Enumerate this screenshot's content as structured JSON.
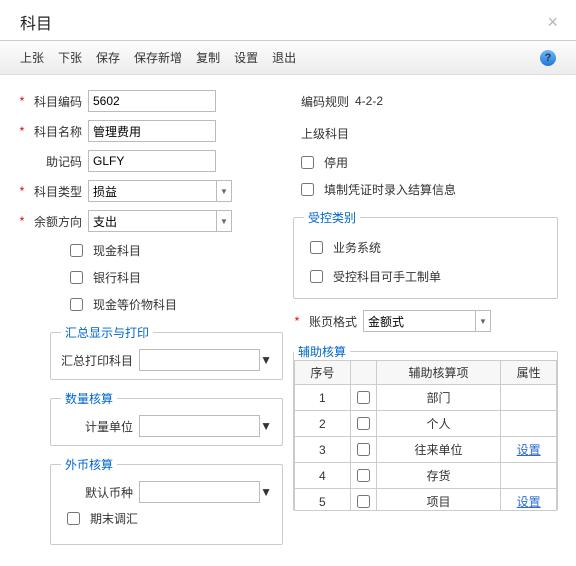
{
  "header": {
    "title": "科目"
  },
  "toolbar": {
    "prev": "上张",
    "next": "下张",
    "save": "保存",
    "saveNew": "保存新增",
    "copy": "复制",
    "settings": "设置",
    "exit": "退出"
  },
  "left": {
    "codeLabel": "科目编码",
    "code": "5602",
    "nameLabel": "科目名称",
    "name": "管理费用",
    "mnemLabel": "助记码",
    "mnem": "GLFY",
    "typeLabel": "科目类型",
    "type": "损益",
    "dirLabel": "余额方向",
    "dir": "支出",
    "chk_cash": "现金科目",
    "chk_bank": "银行科目",
    "chk_cashEq": "现金等价物科目",
    "groups": {
      "sumPrint": {
        "legend": "汇总显示与打印",
        "fieldLabel": "汇总打印科目",
        "value": ""
      },
      "qty": {
        "legend": "数量核算",
        "fieldLabel": "计量单位",
        "value": ""
      },
      "fx": {
        "legend": "外币核算",
        "fieldLabel": "默认币种",
        "value": "",
        "eopAdj": "期末调汇"
      }
    }
  },
  "right": {
    "codeRuleLabel": "编码规则",
    "codeRule": "4-2-2",
    "parentLabel": "上级科目",
    "chk_disable": "停用",
    "chk_voucherJS": "填制凭证时录入结算信息",
    "ctrlCat": {
      "legend": "受控类别",
      "chk_biz": "业务系统",
      "chk_manual": "受控科目可手工制单"
    },
    "pageFmtLabel": "账页格式",
    "pageFmt": "金额式",
    "auxLegend": "辅助核算",
    "auxCols": {
      "no": "序号",
      "chk": "",
      "item": "辅助核算项",
      "attr": "属性"
    },
    "auxRows": [
      {
        "no": "1",
        "item": "部门",
        "attr": ""
      },
      {
        "no": "2",
        "item": "个人",
        "attr": ""
      },
      {
        "no": "3",
        "item": "往来单位",
        "attr": "设置"
      },
      {
        "no": "4",
        "item": "存货",
        "attr": ""
      },
      {
        "no": "5",
        "item": "项目",
        "attr": "设置"
      }
    ]
  }
}
